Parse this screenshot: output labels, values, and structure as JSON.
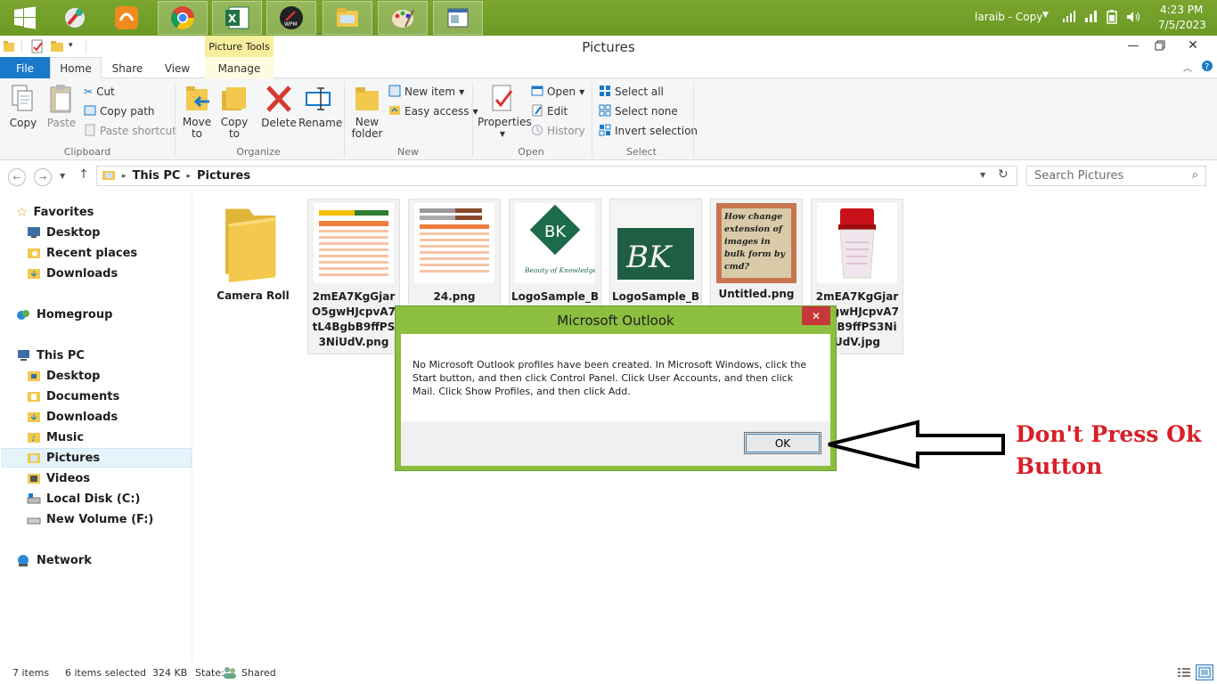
{
  "taskbar": {
    "user_label": "laraib - Copy",
    "time": "4:23 PM",
    "date": "7/5/2023",
    "apps": [
      "start-icon",
      "paint-tool-icon",
      "uc-browser-icon",
      "chrome-icon",
      "excel-icon",
      "wpm-icon",
      "file-explorer-icon",
      "paint-icon",
      "window-icon"
    ]
  },
  "window": {
    "title": "Pictures",
    "context_tab": "Picture Tools"
  },
  "ribbon": {
    "tabs": {
      "file": "File",
      "home": "Home",
      "share": "Share",
      "view": "View",
      "manage": "Manage"
    },
    "clipboard": {
      "copy": "Copy",
      "paste": "Paste",
      "cut": "Cut",
      "copy_path": "Copy path",
      "paste_shortcut": "Paste shortcut",
      "label": "Clipboard"
    },
    "organize": {
      "move_to": "Move",
      "move_to2": "to",
      "copy_to": "Copy",
      "copy_to2": "to",
      "delete": "Delete",
      "rename": "Rename",
      "label": "Organize"
    },
    "new": {
      "new_folder": "New",
      "new_folder2": "folder",
      "new_item": "New item",
      "easy_access": "Easy access",
      "label": "New"
    },
    "open": {
      "properties": "Properties",
      "open": "Open",
      "edit": "Edit",
      "history": "History",
      "label": "Open"
    },
    "select": {
      "select_all": "Select all",
      "select_none": "Select none",
      "invert_selection": "Invert selection",
      "label": "Select"
    }
  },
  "address": {
    "crumbs": [
      "This PC",
      "Pictures"
    ],
    "search_placeholder": "Search Pictures"
  },
  "navpane": {
    "favorites": "Favorites",
    "desktop": "Desktop",
    "recent_places": "Recent places",
    "downloads": "Downloads",
    "homegroup": "Homegroup",
    "this_pc": "This PC",
    "pc_desktop": "Desktop",
    "documents": "Documents",
    "pc_downloads": "Downloads",
    "music": "Music",
    "pictures": "Pictures",
    "videos": "Videos",
    "local_disk": "Local Disk (C:)",
    "new_volume": "New Volume (F:)",
    "network": "Network"
  },
  "files": [
    {
      "name": "Camera Roll"
    },
    {
      "name": "2mEA7KgGjarO5gwHJcpvA7tL4BgbB9ffPS3NiUdV.png"
    },
    {
      "name": "24.png"
    },
    {
      "name": "LogoSample_B"
    },
    {
      "name": "LogoSample_B"
    },
    {
      "name": "Untitled.png"
    },
    {
      "name": "2mEA7KgGjarO5gwHJcpvA7tLbB9ffPS3NiUdV.jpg"
    }
  ],
  "thumb_text": {
    "bk": "BK",
    "bk_caption": "Beauty of Knowledge",
    "untitled": "How change extension of images in bulk form by cmd?"
  },
  "status": {
    "items": "7 items",
    "selected": "6 items selected  324 KB",
    "state_label": "State:",
    "state_value": "Shared"
  },
  "dialog": {
    "title": "Microsoft Outlook",
    "message": "No Microsoft Outlook profiles have been created. In Microsoft Windows, click the Start button, and then click Control Panel. Click User Accounts, and then click Mail. Click Show Profiles, and then click Add.",
    "ok": "OK"
  },
  "annotation": {
    "line1": "Don't Press Ok",
    "line2": "Button",
    "color": "#d81f27"
  }
}
